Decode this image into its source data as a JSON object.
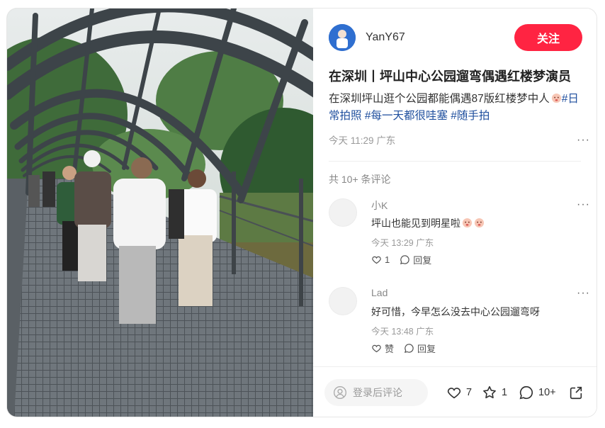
{
  "author": {
    "name": "YanY67"
  },
  "follow_label": "关注",
  "post": {
    "title": "在深圳丨坪山中心公园遛弯偶遇红楼梦演员",
    "desc_text": "在深圳坪山逛个公园都能偶遇87版红楼梦中人",
    "tags": [
      "#日常拍照",
      "#每一天都很哇塞",
      "#随手拍"
    ],
    "time": "今天 11:29",
    "location": "广东"
  },
  "comments_header": "共 10+ 条评论",
  "comments": [
    {
      "name": "小K",
      "text": "坪山也能见到明星啦",
      "time": "今天 13:29",
      "location": "广东",
      "like_label": "1",
      "reply_label": "回复"
    },
    {
      "name": "Lad",
      "text": "好可惜，今早怎么没去中心公园遛弯呀",
      "time": "今天 13:48",
      "location": "广东",
      "like_label": "赞",
      "reply_label": "回复"
    }
  ],
  "bottom": {
    "comment_placeholder": "登录后评论",
    "likes": "7",
    "collects": "1",
    "comments": "10+"
  },
  "icons": {
    "more": "more-dots-icon",
    "heart": "heart-icon",
    "star": "star-icon",
    "chat": "chat-bubble-icon",
    "share": "share-icon",
    "user": "user-outline-icon"
  },
  "colors": {
    "accent": "#ff2442",
    "tag": "#1f4f9e"
  }
}
